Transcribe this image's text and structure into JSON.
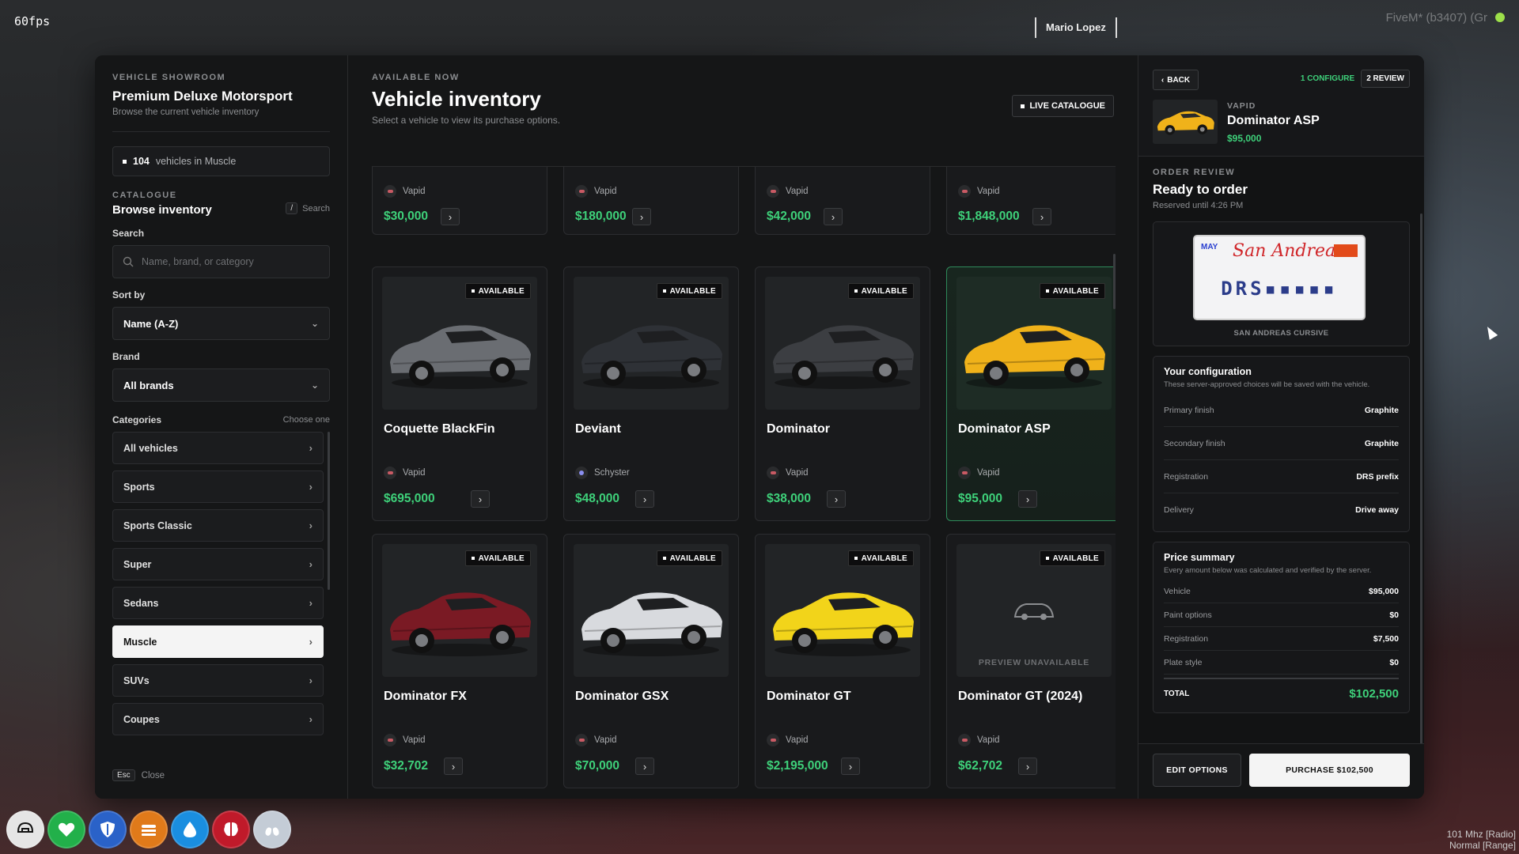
{
  "hud": {
    "fps": "60fps",
    "player_name": "Mario Lopez",
    "server_tag": "FiveM* (b3407) (Gr",
    "radio_line1": "101 Mhz [Radio]",
    "radio_line2": "Normal [Range]",
    "icons": [
      {
        "name": "helmet-icon",
        "color": "#e5e5e5"
      },
      {
        "name": "heart-icon",
        "color": "#22b04a"
      },
      {
        "name": "shield-icon",
        "color": "#2a62c8"
      },
      {
        "name": "food-icon",
        "color": "#e07a1a"
      },
      {
        "name": "water-icon",
        "color": "#1a8ee0"
      },
      {
        "name": "brain-icon",
        "color": "#c01a2a"
      },
      {
        "name": "lungs-icon",
        "color": "#c4ccd6"
      }
    ]
  },
  "sidebar": {
    "eyebrow": "VEHICLE SHOWROOM",
    "title": "Premium Deluxe Motorsport",
    "subtitle": "Browse the current vehicle inventory",
    "count_value": "104",
    "count_label": "vehicles in Muscle",
    "catalogue_eyebrow": "CATALOGUE",
    "browse_title": "Browse inventory",
    "search_key": "/",
    "search_hint": "Search",
    "search_label": "Search",
    "search_placeholder": "Name, brand, or category",
    "sort_label": "Sort by",
    "sort_value": "Name (A-Z)",
    "brand_label": "Brand",
    "brand_value": "All brands",
    "categories_label": "Categories",
    "categories_hint": "Choose one",
    "categories": [
      {
        "label": "All vehicles",
        "active": false
      },
      {
        "label": "Sports",
        "active": false
      },
      {
        "label": "Sports Classic",
        "active": false
      },
      {
        "label": "Super",
        "active": false
      },
      {
        "label": "Sedans",
        "active": false
      },
      {
        "label": "Muscle",
        "active": true
      },
      {
        "label": "SUVs",
        "active": false
      },
      {
        "label": "Coupes",
        "active": false
      }
    ],
    "close_key": "Esc",
    "close_label": "Close"
  },
  "center": {
    "eyebrow": "AVAILABLE NOW",
    "title": "Vehicle inventory",
    "subtitle": "Select a vehicle to view its purchase options.",
    "live_label": "LIVE CATALOGUE",
    "top_row": [
      {
        "brand": "Vapid",
        "price": "$30,000"
      },
      {
        "brand": "Vapid",
        "price": "$180,000"
      },
      {
        "brand": "Vapid",
        "price": "$42,000"
      },
      {
        "brand": "Vapid",
        "price": "$1,848,000"
      }
    ],
    "cards": [
      {
        "name": "Coquette BlackFin",
        "brand": "Vapid",
        "price": "$695,000",
        "badge": "AVAILABLE",
        "color": "#6a6d72",
        "selected": false
      },
      {
        "name": "Deviant",
        "brand": "Schyster",
        "price": "$48,000",
        "badge": "AVAILABLE",
        "color": "#2e3136",
        "selected": false
      },
      {
        "name": "Dominator",
        "brand": "Vapid",
        "price": "$38,000",
        "badge": "AVAILABLE",
        "color": "#3c3e42",
        "selected": false
      },
      {
        "name": "Dominator ASP",
        "brand": "Vapid",
        "price": "$95,000",
        "badge": "AVAILABLE",
        "color": "#f0b21a",
        "selected": true
      },
      {
        "name": "Dominator FX",
        "brand": "Vapid",
        "price": "$32,702",
        "badge": "AVAILABLE",
        "color": "#7a1a24",
        "selected": false
      },
      {
        "name": "Dominator GSX",
        "brand": "Vapid",
        "price": "$70,000",
        "badge": "AVAILABLE",
        "color": "#d8dade",
        "selected": false
      },
      {
        "name": "Dominator GT",
        "brand": "Vapid",
        "price": "$2,195,000",
        "badge": "AVAILABLE",
        "color": "#f2d41a",
        "selected": false
      },
      {
        "name": "Dominator GT (2024)",
        "brand": "Vapid",
        "price": "$62,702",
        "badge": "AVAILABLE",
        "color": "",
        "selected": false,
        "unavailable": "PREVIEW UNAVAILABLE"
      }
    ]
  },
  "right": {
    "back_label": "BACK",
    "step1": "1 CONFIGURE",
    "step2": "2 REVIEW",
    "vehicle_brand": "VAPID",
    "vehicle_name": "Dominator ASP",
    "vehicle_price": "$95,000",
    "review_eyebrow": "ORDER REVIEW",
    "review_title": "Ready to order",
    "review_sub": "Reserved until 4:26 PM",
    "plate": {
      "month": "MAY",
      "state": "San Andreas",
      "number": "DRS▪▪▪▪▪",
      "label": "SAN ANDREAS CURSIVE"
    },
    "config_title": "Your configuration",
    "config_sub": "These server-approved choices will be saved with the vehicle.",
    "config_rows": [
      {
        "k": "Primary finish",
        "v": "Graphite"
      },
      {
        "k": "Secondary finish",
        "v": "Graphite"
      },
      {
        "k": "Registration",
        "v": "DRS prefix"
      },
      {
        "k": "Delivery",
        "v": "Drive away"
      }
    ],
    "price_title": "Price summary",
    "price_sub": "Every amount below was calculated and verified by the server.",
    "price_rows": [
      {
        "k": "Vehicle",
        "v": "$95,000"
      },
      {
        "k": "Paint options",
        "v": "$0"
      },
      {
        "k": "Registration",
        "v": "$7,500"
      },
      {
        "k": "Plate style",
        "v": "$0"
      }
    ],
    "total_label": "TOTAL",
    "total_value": "$102,500",
    "edit_label": "EDIT OPTIONS",
    "purchase_label": "PURCHASE $102,500"
  }
}
